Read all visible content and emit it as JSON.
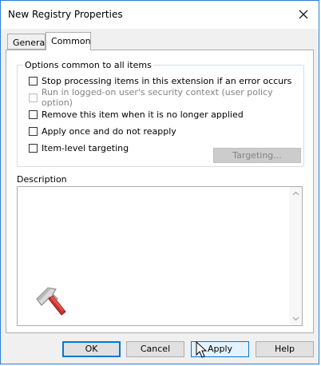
{
  "window": {
    "title": "New Registry Properties"
  },
  "tabs": [
    {
      "label": "General"
    },
    {
      "label": "Common"
    }
  ],
  "common": {
    "group_label": "Options common to all items",
    "options": [
      {
        "label": "Stop processing items in this extension if an error occurs",
        "checked": false,
        "enabled": true
      },
      {
        "label": "Run in logged-on user's security context (user policy option)",
        "checked": false,
        "enabled": false
      },
      {
        "label": "Remove this item when it is no longer applied",
        "checked": false,
        "enabled": true
      },
      {
        "label": "Apply once and do not reapply",
        "checked": false,
        "enabled": true
      },
      {
        "label": "Item-level targeting",
        "checked": false,
        "enabled": true
      }
    ],
    "targeting_button": "Targeting...",
    "description_label": "Description",
    "description_value": ""
  },
  "buttons": {
    "ok": "OK",
    "cancel": "Cancel",
    "apply": "Apply",
    "help": "Help"
  },
  "colors": {
    "accent": "#0078d7",
    "window_border": "#2b7fd6",
    "client_bg": "#f0f0f0"
  }
}
